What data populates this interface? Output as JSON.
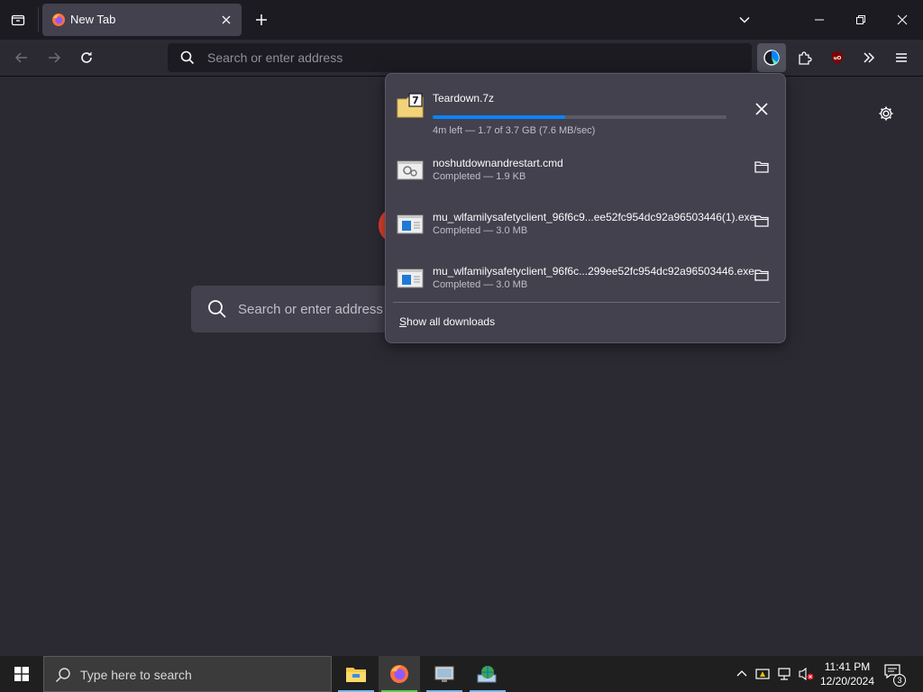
{
  "tab": {
    "title": "New Tab"
  },
  "urlbar": {
    "placeholder": "Search or enter address"
  },
  "page": {
    "search_placeholder": "Search or enter address"
  },
  "downloads": {
    "items": [
      {
        "name": "Teardown.7z",
        "status": "4m left — 1.7 of 3.7 GB (7.6 MB/sec)",
        "progress": 0.45,
        "icon": "archive-7z-icon",
        "action": "cancel"
      },
      {
        "name": "noshutdownandrestart.cmd",
        "status": "Completed — 1.9 KB",
        "icon": "cmd-file-icon",
        "action": "show-in-folder"
      },
      {
        "name": "mu_wlfamilysafetyclient_96f6c9...ee52fc954dc92a96503446(1).exe",
        "status": "Completed — 3.0 MB",
        "icon": "exe-file-icon",
        "action": "show-in-folder"
      },
      {
        "name": "mu_wlfamilysafetyclient_96f6c...299ee52fc954dc92a96503446.exe",
        "status": "Completed — 3.0 MB",
        "icon": "exe-file-icon",
        "action": "show-in-folder"
      }
    ],
    "show_all_label": "Show all downloads"
  },
  "taskbar": {
    "search_text": "Type here to search",
    "time": "11:41 PM",
    "date": "12/20/2024",
    "notification_count": "3"
  },
  "colors": {
    "accent": "#0a84ff",
    "panel": "#42414d",
    "toolbar": "#2b2a33",
    "tabstrip": "#1c1b22"
  }
}
